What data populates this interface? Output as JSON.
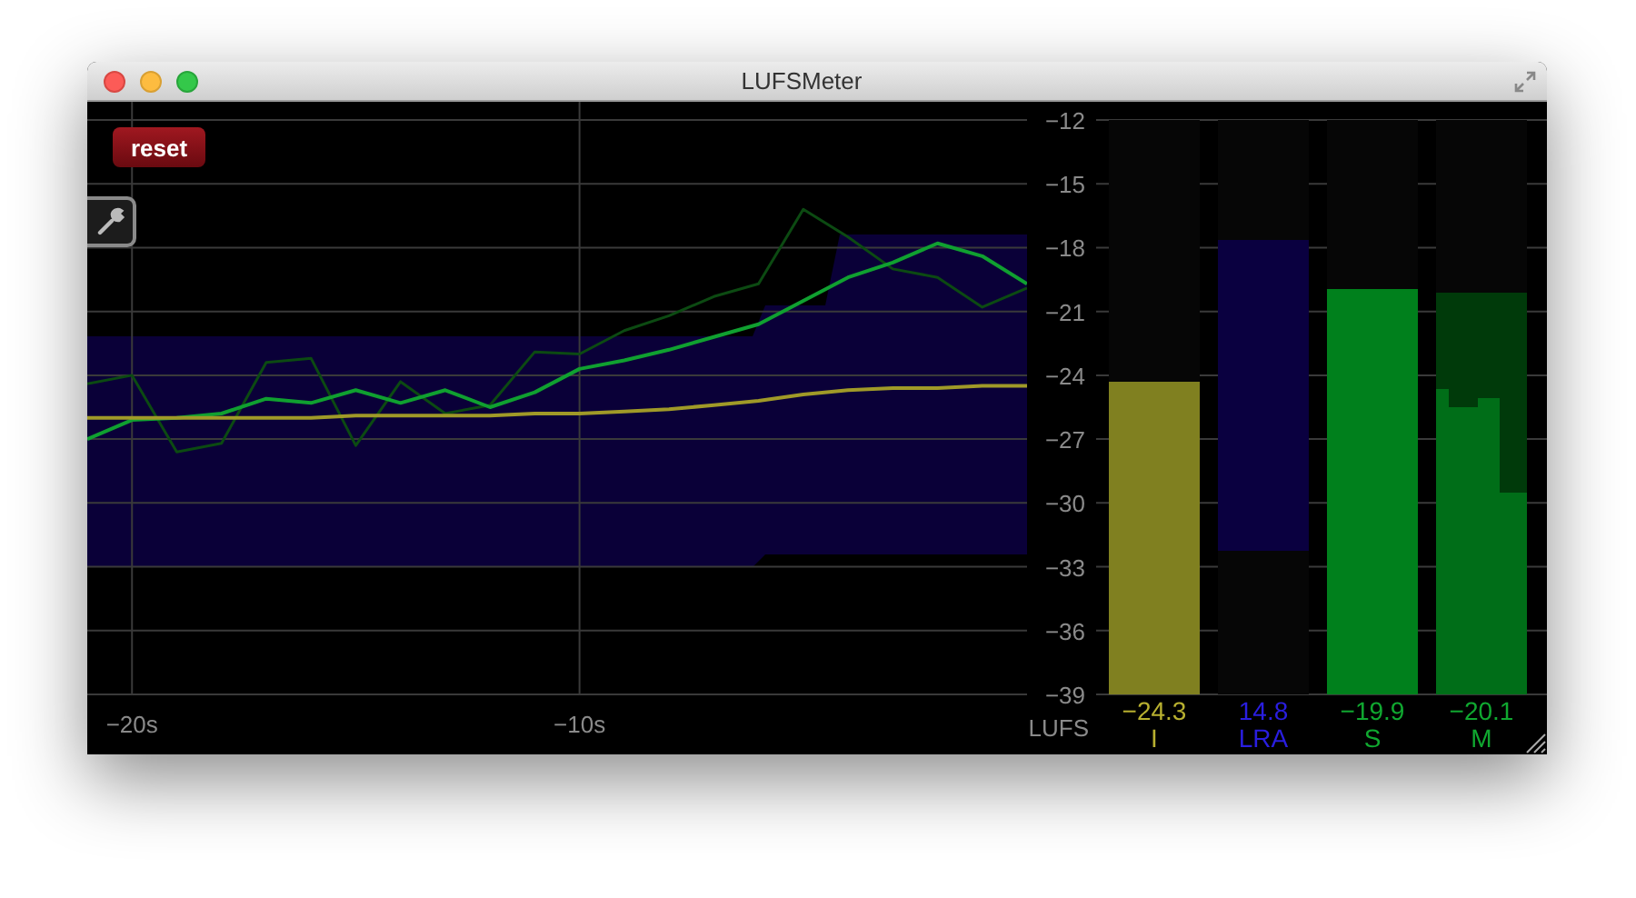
{
  "window": {
    "title": "LUFSMeter"
  },
  "reset_button": {
    "label": "reset"
  },
  "history": {
    "chart_data": {
      "type": "line",
      "ylabel": "LUFS",
      "x": [
        -21,
        -20,
        -19,
        -18,
        -17,
        -16,
        -15,
        -14,
        -13,
        -12,
        -11,
        -10,
        -9,
        -8,
        -7,
        -6,
        -5,
        -4,
        -3,
        -2,
        -1,
        0
      ],
      "xlim": [
        -21,
        0
      ],
      "ylim": [
        -39,
        -12
      ],
      "xticks": [
        {
          "value": -20,
          "label": "−20s"
        },
        {
          "value": -10,
          "label": "−10s"
        }
      ],
      "yticks": [
        {
          "value": -12,
          "label": "−12"
        },
        {
          "value": -15,
          "label": "−15"
        },
        {
          "value": -18,
          "label": "−18"
        },
        {
          "value": -21,
          "label": "−21"
        },
        {
          "value": -24,
          "label": "−24"
        },
        {
          "value": -27,
          "label": "−27"
        },
        {
          "value": -30,
          "label": "−30"
        },
        {
          "value": -33,
          "label": "−33"
        },
        {
          "value": -36,
          "label": "−36"
        },
        {
          "value": -39,
          "label": "−39"
        }
      ],
      "series": [
        {
          "color": "#0c4a12",
          "values": [
            -24.4,
            -24.0,
            -27.6,
            -27.2,
            -23.4,
            -23.2,
            -27.3,
            -24.3,
            -25.8,
            -25.4,
            -22.9,
            -23.0,
            -21.9,
            -21.2,
            -20.3,
            -19.7,
            -16.2,
            -17.5,
            -19.0,
            -19.4,
            -20.8,
            -19.9
          ]
        },
        {
          "color": "#10a030",
          "values": [
            -27.0,
            -26.1,
            -26.0,
            -25.8,
            -25.1,
            -25.3,
            -24.7,
            -25.3,
            -24.7,
            -25.5,
            -24.8,
            -23.7,
            -23.3,
            -22.8,
            -22.2,
            -21.6,
            -20.5,
            -19.4,
            -18.7,
            -17.8,
            -18.4,
            -19.7
          ]
        },
        {
          "color": "#a09a28",
          "values": [
            -26.0,
            -26.0,
            -26.0,
            -26.0,
            -26.0,
            -26.0,
            -25.9,
            -25.9,
            -25.9,
            -25.9,
            -25.8,
            -25.8,
            -25.7,
            -25.6,
            -25.4,
            -25.2,
            -24.9,
            -24.7,
            -24.6,
            -24.6,
            -24.5,
            -24.5
          ]
        }
      ]
    }
  },
  "meters": [
    {
      "kind": "bar",
      "name": "I",
      "reading": "−24.3",
      "level": 0.544,
      "color": "#808020"
    },
    {
      "kind": "range",
      "name": "LRA",
      "reading": "14.8",
      "color": "#0a0040"
    },
    {
      "kind": "bar",
      "name": "S",
      "reading": "−19.9",
      "level": 0.707,
      "color": "#00801c"
    },
    {
      "kind": "stepped",
      "name": "M",
      "reading": "−20.1",
      "level": 0.7,
      "color": "#006e18"
    }
  ]
}
